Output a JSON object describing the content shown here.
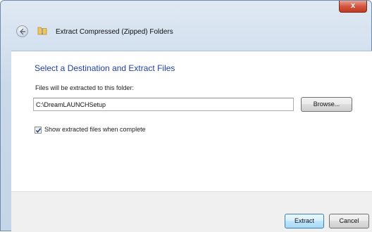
{
  "window": {
    "title": "Extract Compressed (Zipped) Folders",
    "close_glyph": "x"
  },
  "icons": {
    "back": "back-arrow-icon",
    "folder": "zip-folder-icon",
    "close": "close-icon",
    "check": "checkmark-icon"
  },
  "content": {
    "heading": "Select a Destination and Extract Files",
    "field_label": "Files will be extracted to this folder:",
    "path_value": "C:\\DreamLAUNCHSetup",
    "browse_label": "Browse...",
    "show_files_label": "Show extracted files when complete",
    "show_files_checked": true
  },
  "footer": {
    "extract_label": "Extract",
    "cancel_label": "Cancel"
  },
  "colors": {
    "heading": "#1f3fa6",
    "close_button": "#c23a22"
  }
}
